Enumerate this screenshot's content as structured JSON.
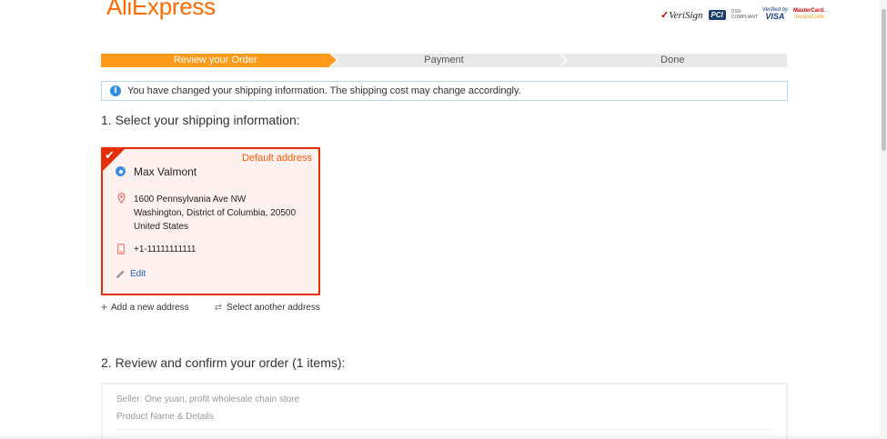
{
  "brand": {
    "logo_text": "AliExpress",
    "logo_mark": "™",
    "accent": "#ff6a00"
  },
  "trust_badges": {
    "verisign": "VeriSign",
    "pci": "PCI",
    "pci_tag": "DSS COMPLIANT",
    "visa_top": "Verified by",
    "visa_main": "VISA",
    "mc_top": "MasterCard.",
    "mc_bottom": "SecureCode"
  },
  "steps": [
    {
      "label": "Review your Order",
      "active": true
    },
    {
      "label": "Payment",
      "active": false
    },
    {
      "label": "Done",
      "active": false
    }
  ],
  "notice": {
    "icon": "info-icon",
    "text": "You have changed your shipping information. The shipping cost may change accordingly."
  },
  "shipping": {
    "title": "1. Select your shipping information:",
    "card": {
      "default_label": "Default address",
      "name": "Max Valmont",
      "address_line1": "1600 Pennsylvania Ave NW",
      "address_line2": "Washington, District of Columbia, 20500",
      "address_line3": "United States",
      "phone": "+1-11111111111",
      "edit_label": "Edit",
      "selected_color": "#e62e04"
    },
    "add_address_label": "Add a new address",
    "select_another_label": "Select another address"
  },
  "review": {
    "title": "2. Review and confirm your order (1 items):",
    "seller": "Seller: One yuan, profit wholesale chain store",
    "product_header": "Product Name & Details"
  }
}
